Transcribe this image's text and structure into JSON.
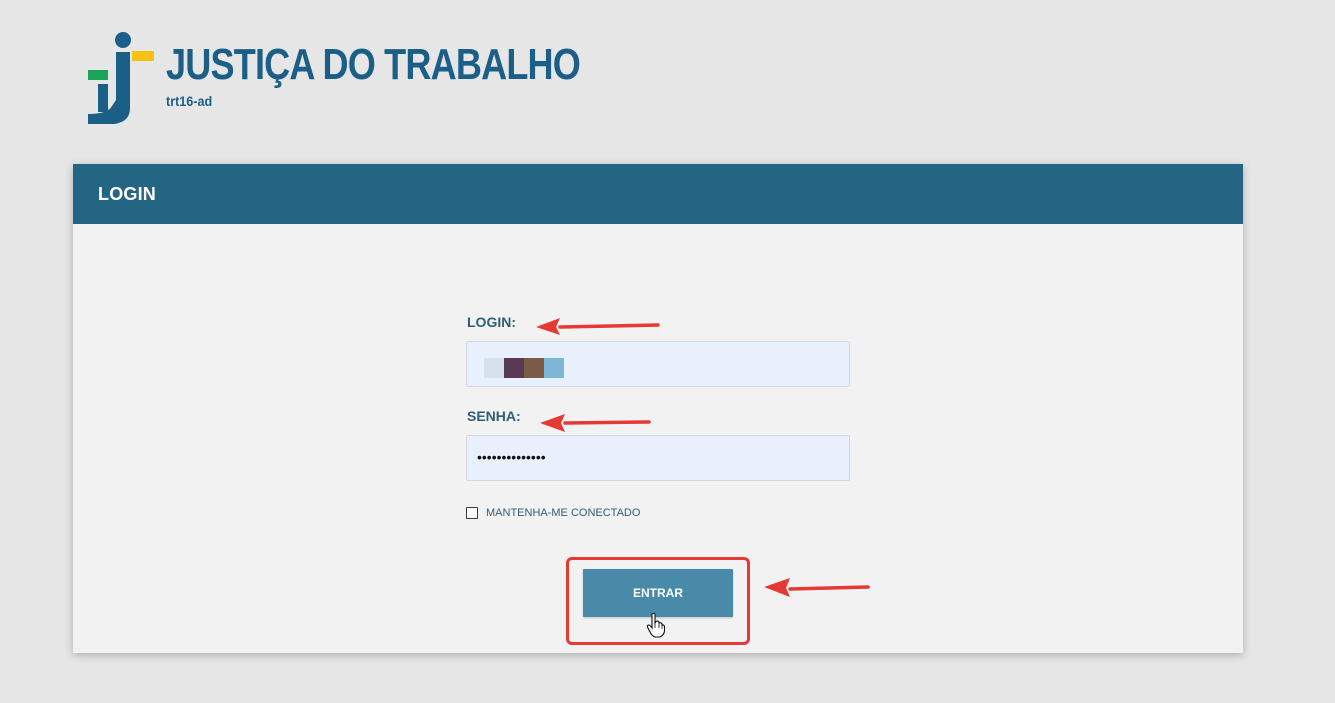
{
  "brand": {
    "title": "JUSTIÇA DO TRABALHO",
    "subtitle": "trt16-ad",
    "colors": {
      "blue": "#1b5e86",
      "green": "#1aa35b",
      "yellow": "#f6c20f"
    }
  },
  "card": {
    "title": "LOGIN",
    "header_color": "#256584"
  },
  "form": {
    "login_label": "LOGIN:",
    "login_value": "",
    "password_label": "SENHA:",
    "password_mask": "••••••••••••••",
    "remember_label": "MANTENHA-ME CONECTADO",
    "remember_checked": false,
    "submit_label": "ENTRAR"
  },
  "annotations": {
    "arrow_color": "#e53935",
    "icons": [
      "arrow-left-icon",
      "hand-pointer-icon"
    ]
  }
}
